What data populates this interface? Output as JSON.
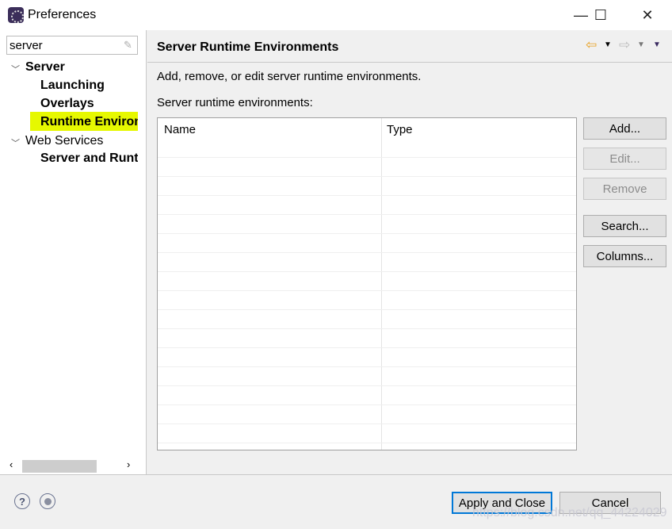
{
  "window": {
    "title": "Preferences",
    "controls": {
      "minimize": "—",
      "maximize": "☐",
      "close": "✕"
    }
  },
  "sidebar": {
    "filter_value": "server",
    "tree": [
      {
        "label": "Server",
        "expanded": true,
        "children": [
          {
            "label": "Launching"
          },
          {
            "label": "Overlays"
          },
          {
            "label": "Runtime Environments",
            "display": "Runtime Environ",
            "selected": true
          }
        ]
      },
      {
        "label": "Web Services",
        "expanded": true,
        "children": [
          {
            "label": "Server and Runtime",
            "display": "Server and Runti"
          }
        ]
      }
    ]
  },
  "page": {
    "title": "Server Runtime Environments",
    "description": "Add, remove, or edit server runtime environments.",
    "list_label": "Server runtime environments:",
    "columns": [
      "Name",
      "Type"
    ],
    "rows": [],
    "nav": {
      "back_color": "#e8a020"
    }
  },
  "buttons": {
    "add": "Add...",
    "edit": "Edit...",
    "remove": "Remove",
    "search": "Search...",
    "columns": "Columns..."
  },
  "footer": {
    "apply_close": "Apply and Close",
    "cancel": "Cancel",
    "help": "?",
    "accent": "#0078d7"
  },
  "watermark": "https://blog.csdn.net/qq_44224029"
}
